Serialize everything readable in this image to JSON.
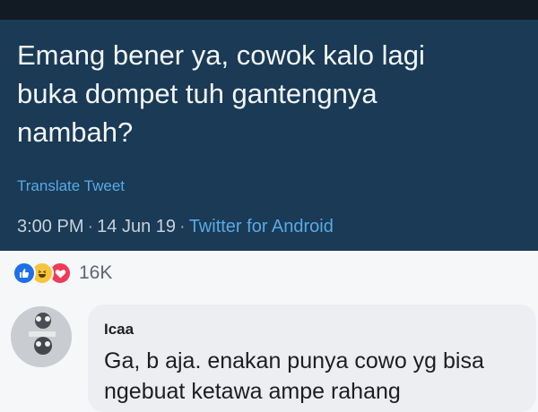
{
  "tweet": {
    "text": "Emang bener ya, cowok kalo lagi\nbuka dompet tuh gantengnya\nnambah?",
    "translate_label": "Translate Tweet",
    "time": "3:00 PM",
    "separator": "·",
    "date": "14 Jun 19",
    "client": "Twitter for Android"
  },
  "reactions": {
    "icons": [
      "like-icon",
      "haha-icon",
      "love-icon"
    ],
    "count": "16K",
    "colors": {
      "like": "#1e6fe8",
      "haha": "#f5c63b",
      "love": "#ee3b57"
    }
  },
  "comment": {
    "author": "Icaa",
    "text": "Ga, b aja. enakan punya cowo yg bisa ngebuat ketawa ampe rahang"
  },
  "colors": {
    "tweet_background": "#1a3a55",
    "link": "#5aa9e6"
  }
}
